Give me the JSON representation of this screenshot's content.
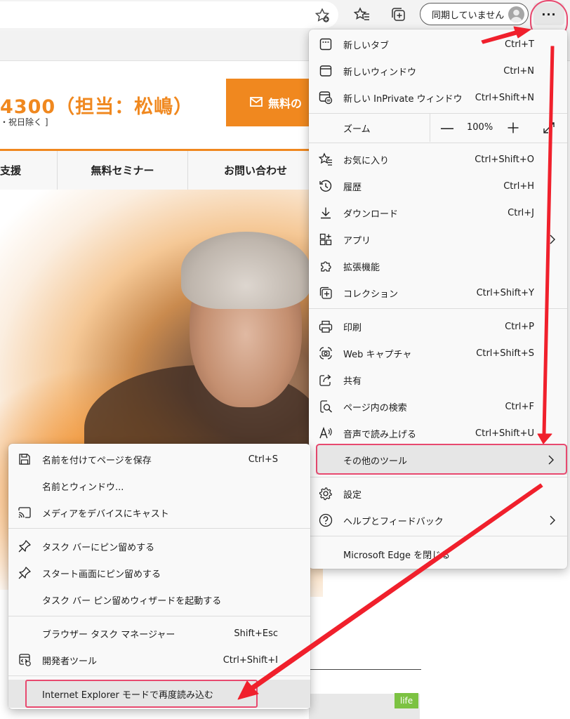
{
  "toolbar": {
    "sync_label": "同期していません",
    "more_label": "···"
  },
  "page": {
    "phone": "4300（担当：松嶋）",
    "hours": "・祝日除く ]",
    "free_button": "無料の",
    "nav": [
      "支援",
      "無料セミナー",
      "お問い合わせ"
    ],
    "badge": "life"
  },
  "menu": {
    "items": [
      {
        "label": "新しいタブ",
        "shortcut": "Ctrl+T",
        "icon": "new-tab-icon"
      },
      {
        "label": "新しいウィンドウ",
        "shortcut": "Ctrl+N",
        "icon": "new-window-icon"
      },
      {
        "label": "新しい InPrivate ウィンドウ",
        "shortcut": "Ctrl+Shift+N",
        "icon": "inprivate-icon"
      },
      {
        "label": "お気に入り",
        "shortcut": "Ctrl+Shift+O",
        "icon": "favorites-icon"
      },
      {
        "label": "履歴",
        "shortcut": "Ctrl+H",
        "icon": "history-icon"
      },
      {
        "label": "ダウンロード",
        "shortcut": "Ctrl+J",
        "icon": "download-icon"
      },
      {
        "label": "アプリ",
        "shortcut": "",
        "icon": "apps-icon"
      },
      {
        "label": "拡張機能",
        "shortcut": "",
        "icon": "extensions-icon"
      },
      {
        "label": "コレクション",
        "shortcut": "Ctrl+Shift+Y",
        "icon": "collections-icon"
      },
      {
        "label": "印刷",
        "shortcut": "Ctrl+P",
        "icon": "print-icon"
      },
      {
        "label": "Web キャプチャ",
        "shortcut": "Ctrl+Shift+S",
        "icon": "web-capture-icon"
      },
      {
        "label": "共有",
        "shortcut": "",
        "icon": "share-icon"
      },
      {
        "label": "ページ内の検索",
        "shortcut": "Ctrl+F",
        "icon": "find-icon"
      },
      {
        "label": "音声で読み上げる",
        "shortcut": "Ctrl+Shift+U",
        "icon": "read-aloud-icon"
      },
      {
        "label": "その他のツール",
        "shortcut": "",
        "icon": ""
      },
      {
        "label": "設定",
        "shortcut": "",
        "icon": "settings-icon"
      },
      {
        "label": "ヘルプとフィードバック",
        "shortcut": "",
        "icon": "help-icon"
      },
      {
        "label": "Microsoft Edge を閉じる",
        "shortcut": "",
        "icon": ""
      }
    ],
    "zoom_label": "ズーム",
    "zoom_value": "100%",
    "zoom_minus": "—"
  },
  "submenu": {
    "items": [
      {
        "label": "名前を付けてページを保存",
        "shortcut": "Ctrl+S",
        "icon": "save-icon"
      },
      {
        "label": "名前とウィンドウ...",
        "shortcut": "",
        "icon": ""
      },
      {
        "label": "メディアをデバイスにキャスト",
        "shortcut": "",
        "icon": "cast-icon"
      },
      {
        "label": "タスク バーにピン留めする",
        "shortcut": "",
        "icon": "pin-icon"
      },
      {
        "label": "スタート画面にピン留めする",
        "shortcut": "",
        "icon": "pin-icon"
      },
      {
        "label": "タスク バー ピン留めウィザードを起動する",
        "shortcut": "",
        "icon": ""
      },
      {
        "label": "ブラウザー タスク マネージャー",
        "shortcut": "Shift+Esc",
        "icon": ""
      },
      {
        "label": "開発者ツール",
        "shortcut": "Ctrl+Shift+I",
        "icon": "devtools-icon"
      },
      {
        "label": "Internet Explorer モードで再度読み込む",
        "shortcut": "",
        "icon": ""
      }
    ]
  },
  "colors": {
    "accent_orange": "#f0881f",
    "highlight_pink": "#e8496f",
    "arrow_red": "#f0202c"
  }
}
